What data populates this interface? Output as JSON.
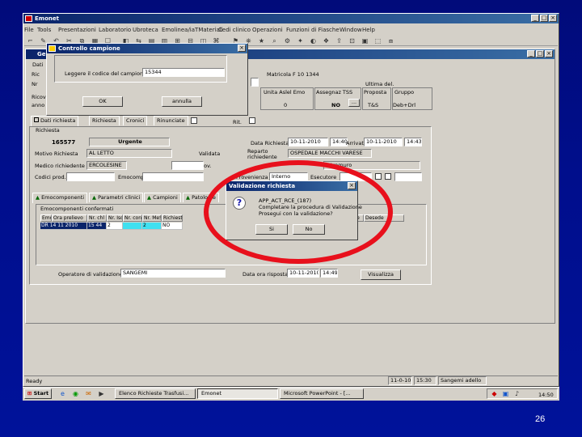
{
  "app": {
    "title": "Emonet"
  },
  "menu": [
    "File",
    "Tools",
    "Presentazioni",
    "Laboratorio",
    "Ubroteca",
    "Emolinea/iaTMateriali",
    "Cedi clinico",
    "Operazioni",
    "Funzioni di Fiasche",
    "Window",
    "Help"
  ],
  "child": {
    "title": "Gest"
  },
  "controllo": {
    "title": "Controllo campione",
    "prompt": "Leggere il codice del campione",
    "value": "15344",
    "ok": "OK",
    "annulla": "annulla"
  },
  "form": {
    "dati_label": "Dati",
    "ric_label": "Ric",
    "num_label": "Nr",
    "num_value": "165577",
    "matricola_label": "Matricola",
    "matricola_value": "F 10 1344",
    "ultima_label": "Ultima del.",
    "cols": {
      "unita": "Unita Aslel Emo",
      "assegnaz": "Assegnaz TSS",
      "proposta": "Proposta",
      "gruppo": "Gruppo"
    },
    "vals": {
      "unita": "0",
      "assegnaz": "NO",
      "proposta": "T&S",
      "gruppo": "Deb+Drl"
    },
    "ricovero_label": "Ricove",
    "anno_label": "anno"
  },
  "tabs_top": [
    "Dati richiesta",
    "Richiesta",
    "Cronici",
    "Rinunciate"
  ],
  "rit_label": "Rit.",
  "richiesta": {
    "section": "Richiesta",
    "number": "165577",
    "urgency": "Urgente",
    "data_label": "Data Richiesta",
    "data_value": "10-11-2010",
    "data_time": "14:40",
    "arrivo_label": "Arrivata",
    "arrivo_value": "10-11-2010",
    "arrivo_time": "14:43",
    "motivo_label": "Motivo Richiesta",
    "motivo_value": "AL LETTO",
    "validata_label": "Validata",
    "reparto_label": "Reparto richiedente",
    "reparto_value": "OSPEDALE MACCHI VARESE",
    "medico_label": "Medico richiedente",
    "medico_value": "ERCOLESINE",
    "nota_label": "Nota prov.",
    "prossimo_label": "In turnone",
    "prossimo_value": "Intramuro",
    "codici_label": "Codici prod.",
    "emocomp_label": "Emocomp.",
    "provenienza_label": "Provenienza",
    "provenienza_value": "Interno",
    "esecutore_label": "Esecutore"
  },
  "tabs_mid": [
    "Emocomponenti",
    "Parametri clinici",
    "Campioni",
    "Patologie"
  ],
  "emocomp": {
    "section": "Emocomponenti confermati",
    "headers": [
      "Emo",
      "Ora prelievo",
      "Nr. chl",
      "Nr. Iso",
      "Nr. con.",
      "Nr. MeSo",
      "Richiesto",
      "Dedelle",
      "Desede"
    ],
    "row": [
      "DR 14 11 2010",
      "15 44",
      "2",
      "",
      "2",
      "NO"
    ]
  },
  "operatore_label": "Operatore di validazione",
  "operatore_value": "SANGEMI",
  "dataora_label": "Data ora risposta",
  "dataora_value": "10-11-2010",
  "dataora_time": "14:49",
  "visualizza": "Visualizza",
  "validazione": {
    "title": "Validazione richiesta",
    "code": "APP_ACT_RCE_(187)",
    "line1": "Completare la procedura di Validazione",
    "line2": "Prosegui con la validazione?",
    "yes": "Si",
    "no": "No"
  },
  "status": {
    "left": "Ready",
    "date": "11-0-10",
    "time": "15:30",
    "user": "Sangemi adello"
  },
  "taskbar": {
    "start": "Start",
    "items": [
      "Elenco Richieste Trasfusi...",
      "Emonet",
      "Microsoft PowerPoint - [..."
    ],
    "clock": "14:50"
  },
  "accent": "#e8101c",
  "page_number": "26"
}
